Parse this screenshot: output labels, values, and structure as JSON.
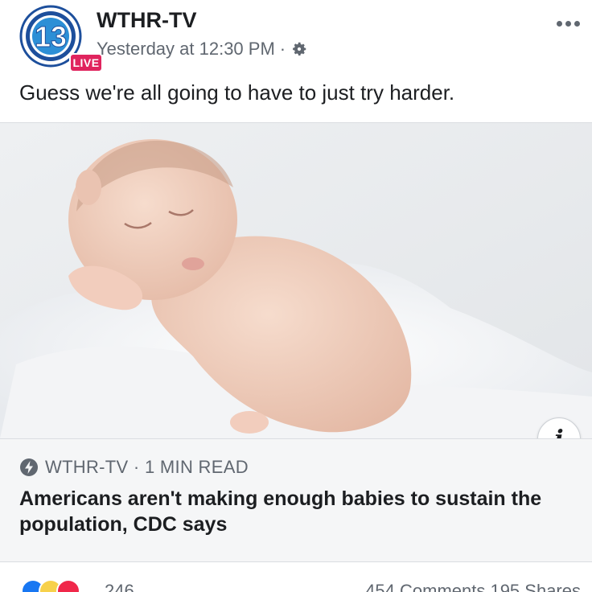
{
  "post": {
    "page_name": "WTHR-TV",
    "avatar_number": "13",
    "live_badge": "LIVE",
    "timestamp": "Yesterday at 12:30 PM",
    "separator": "·",
    "caption": "Guess we're all going to have to just try harder."
  },
  "link_preview": {
    "image_icon": "sleeping-baby-photo",
    "info_label": "i",
    "source": "WTHR-TV · 1 MIN READ",
    "headline": "Americans aren't making enough babies to sustain the population, CDC says"
  },
  "footer": {
    "reaction_count": "246",
    "comments_shares": "454 Comments  195 Shares"
  },
  "colors": {
    "live_red": "#e0245e",
    "like_blue": "#1877f2",
    "secondary_text": "#606770"
  }
}
